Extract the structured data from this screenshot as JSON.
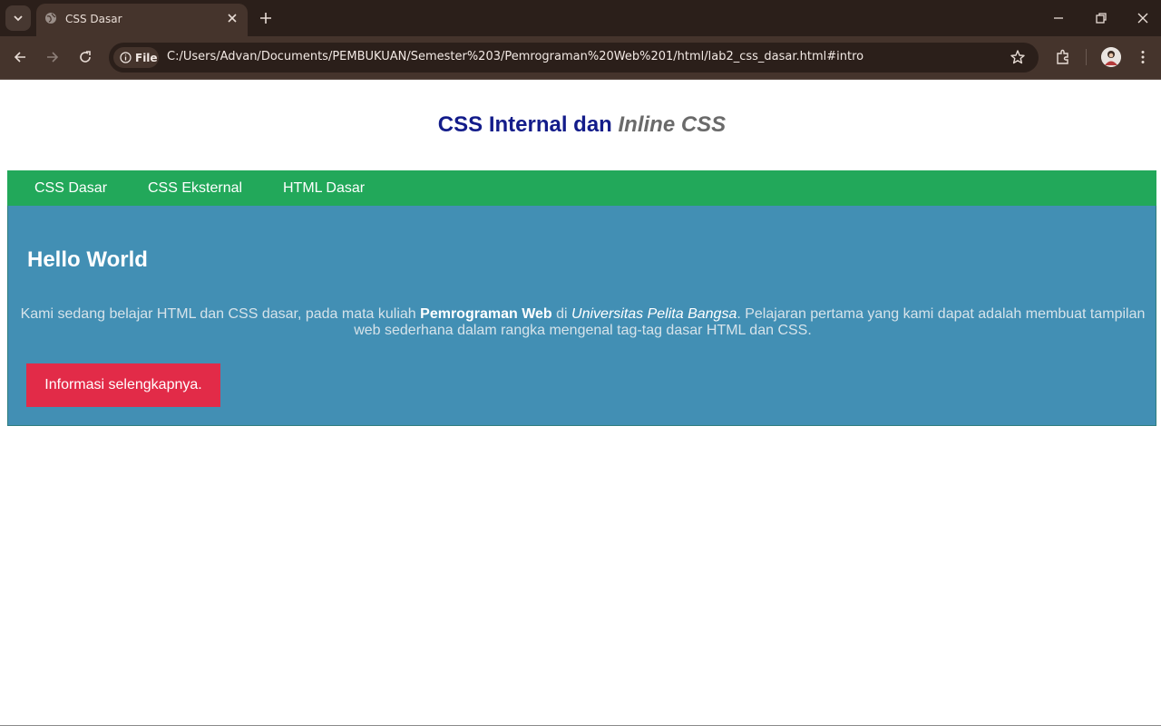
{
  "browser": {
    "tab_title": "CSS Dasar",
    "security_chip": "File",
    "url": "C:/Users/Advan/Documents/PEMBUKUAN/Semester%203/Pemrograman%20Web%201/html/lab2_css_dasar.html#intro"
  },
  "page": {
    "title_main": "CSS Internal dan ",
    "title_em": "Inline CSS",
    "nav": [
      "CSS Dasar",
      "CSS Eksternal",
      "HTML Dasar"
    ],
    "intro": {
      "heading": "Hello World",
      "text_1": "Kami sedang belajar HTML dan CSS dasar, pada mata kuliah ",
      "text_bold": "Pemrograman Web",
      "text_2": " di ",
      "text_italic": "Universitas Pelita Bangsa",
      "text_3": ". Pelajaran pertama yang kami dapat adalah membuat tampilan web sederhana dalam rangka mengenal tag-tag dasar HTML dan CSS.",
      "button": "Informasi selengkapnya."
    }
  },
  "colors": {
    "title": "#131c8a",
    "title_em": "#6a6a6a",
    "navbar": "#22a85a",
    "intro_bg": "#428fb4",
    "button": "#e22b48"
  },
  "icons": [
    "tab-search-icon",
    "globe-icon",
    "close-icon",
    "plus-icon",
    "minimize-icon",
    "restore-icon",
    "back-icon",
    "forward-icon",
    "reload-icon",
    "info-icon",
    "star-icon",
    "extensions-icon",
    "profile-icon",
    "more-icon"
  ]
}
